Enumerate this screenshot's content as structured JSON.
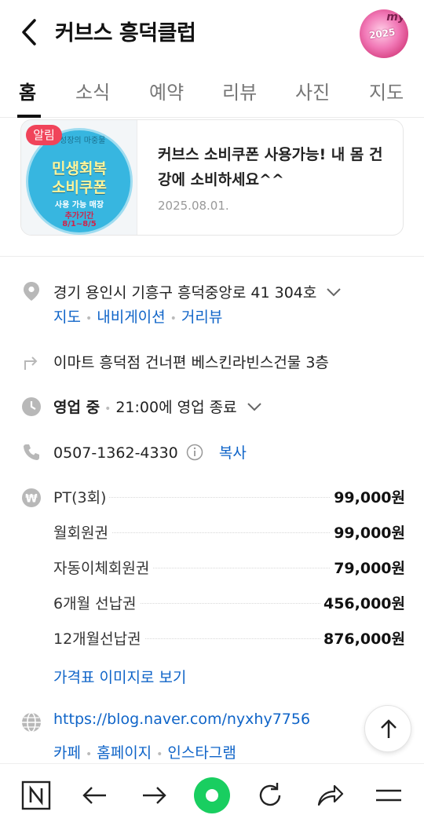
{
  "header": {
    "title": "커브스 흥덕클럽",
    "back_icon": "chevron-left-icon",
    "avatar": {
      "text_my": "my",
      "text_year": "2025"
    }
  },
  "tabs": [
    {
      "label": "홈",
      "active": true
    },
    {
      "label": "소식",
      "active": false
    },
    {
      "label": "예약",
      "active": false
    },
    {
      "label": "리뷰",
      "active": false
    },
    {
      "label": "사진",
      "active": false
    },
    {
      "label": "지도",
      "active": false
    }
  ],
  "notice": {
    "badge": "알림",
    "title": "커브스 소비쿠폰 사용가능! 내 몸 건강에 소비하세요^^",
    "date": "2025.08.01.",
    "thumb": {
      "ring": "성장의 마중물",
      "line1": "민생회복",
      "line2": "소비쿠폰",
      "line3": "사용 가능 매장",
      "line4": "추가기간",
      "line5": "8/1~8/5"
    }
  },
  "address": {
    "text": "경기 용인시 기흥구 흥덕중앙로 41 304호",
    "links": [
      "지도",
      "내비게이션",
      "거리뷰"
    ]
  },
  "directions": "이마트 흥덕점 건너편 베스킨라빈스건물 3층",
  "hours": {
    "status": "영업 중",
    "detail": "21:00에 영업 종료"
  },
  "phone": {
    "number": "0507-1362-4330",
    "copy": "복사"
  },
  "prices": [
    {
      "name": "PT(3회)",
      "value": "99,000원"
    },
    {
      "name": "월회원권",
      "value": "99,000원"
    },
    {
      "name": "자동이체회원권",
      "value": "79,000원"
    },
    {
      "name": "6개월 선납권",
      "value": "456,000원"
    },
    {
      "name": "12개월선납권",
      "value": "876,000원"
    }
  ],
  "price_image_link": "가격표 이미지로 보기",
  "website": {
    "url": "https://blog.naver.com/nyxhy7756",
    "links": [
      "카페",
      "홈페이지",
      "인스타그램"
    ]
  },
  "colors": {
    "link": "#0f64c8",
    "accent_green": "#19ce60",
    "alert_red": "#f0445a"
  }
}
